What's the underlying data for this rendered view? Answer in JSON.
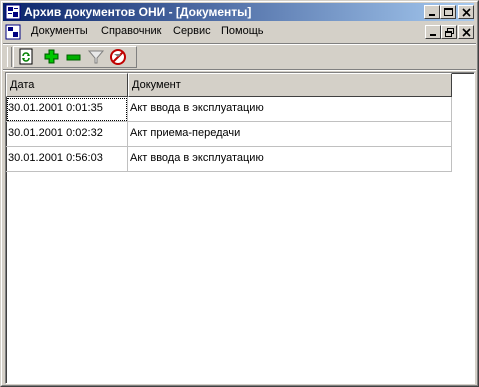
{
  "window": {
    "title": "Архив документов ОНИ - [Документы]"
  },
  "menu": {
    "items": [
      {
        "label": "Документы"
      },
      {
        "label": "Справочник"
      },
      {
        "label": "Сервис"
      },
      {
        "label": "Помощь"
      }
    ]
  },
  "toolbar": {
    "icons": [
      "refresh-icon",
      "add-icon",
      "remove-icon",
      "filter-icon",
      "cancel-filter-icon"
    ]
  },
  "table": {
    "columns": [
      "Дата",
      "Документ"
    ],
    "rows": [
      [
        "30.01.2001 0:01:35",
        "Акт ввода в эксплуатацию"
      ],
      [
        "30.01.2001 0:02:32",
        "Акт приема-передачи"
      ],
      [
        "30.01.2001 0:56:03",
        "Акт ввода в эксплуатацию"
      ]
    ]
  },
  "colors": {
    "title_start": "#0a246a",
    "title_end": "#a6caf0",
    "face": "#d4d0c8"
  }
}
